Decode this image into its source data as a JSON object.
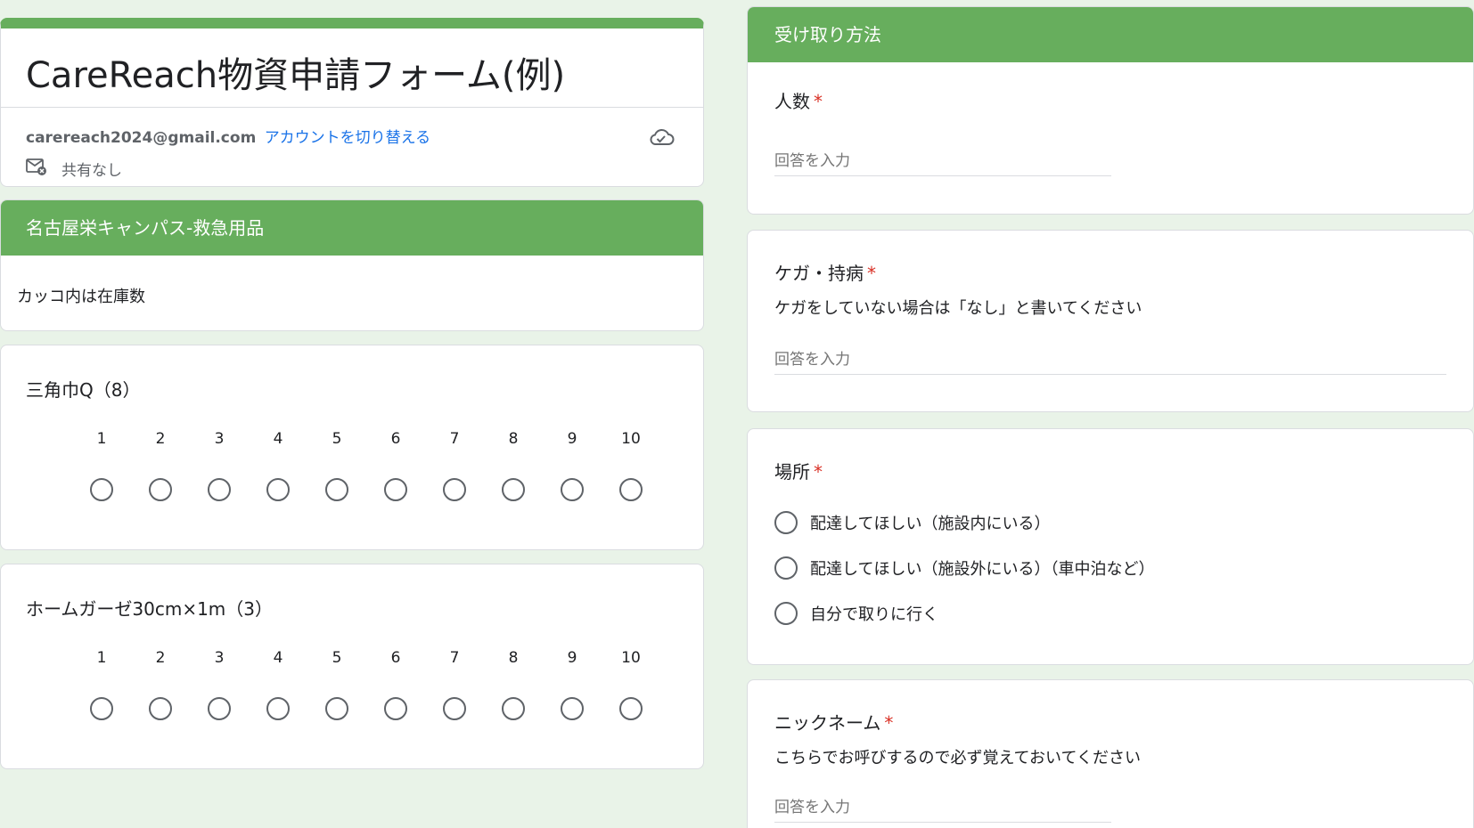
{
  "header": {
    "title": "CareReach物資申請フォーム(例)",
    "email": "carereach2024@gmail.com",
    "switch_account": "アカウントを切り替える",
    "share_status": "共有なし"
  },
  "section1": {
    "title": "名古屋栄キャンパス-救急用品",
    "description": "カッコ内は在庫数"
  },
  "scale_questions": [
    {
      "title": "三角巾Q（8）",
      "numbers": [
        "1",
        "2",
        "3",
        "4",
        "5",
        "6",
        "7",
        "8",
        "9",
        "10"
      ]
    },
    {
      "title": "ホームガーゼ30cm×1m（3）",
      "numbers": [
        "1",
        "2",
        "3",
        "4",
        "5",
        "6",
        "7",
        "8",
        "9",
        "10"
      ]
    }
  ],
  "section2": {
    "title": "受け取り方法"
  },
  "questions": {
    "people": {
      "title": "人数",
      "required_mark": "*",
      "placeholder": "回答を入力"
    },
    "injury": {
      "title": "ケガ・持病",
      "required_mark": "*",
      "subtitle": "ケガをしていない場合は「なし」と書いてください",
      "placeholder": "回答を入力"
    },
    "place": {
      "title": "場所",
      "required_mark": "*",
      "options": [
        "配達してほしい（施設内にいる）",
        "配達してほしい（施設外にいる）（車中泊など）",
        "自分で取りに行く"
      ]
    },
    "nickname": {
      "title": "ニックネーム",
      "required_mark": "*",
      "subtitle": "こちらでお呼びするので必ず覚えておいてください",
      "placeholder": "回答を入力"
    }
  },
  "colors": {
    "accent": "#67ae5d",
    "link": "#1a73e8",
    "required": "#d93025",
    "background": "#e9f3e8"
  },
  "icons": {
    "cloud": "cloud-check-icon",
    "mail": "mail-off-icon"
  }
}
